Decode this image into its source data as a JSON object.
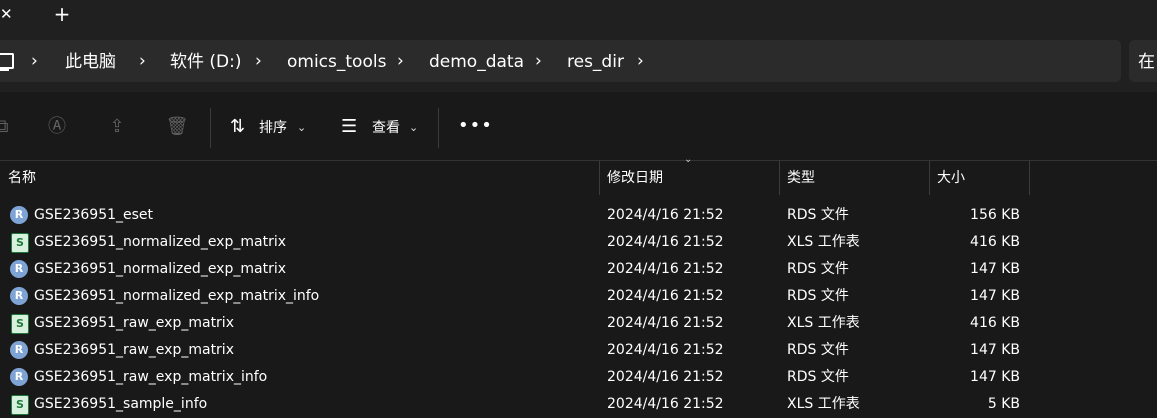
{
  "tab": {
    "close_icon": "close-icon",
    "new_tab_icon": "plus-icon"
  },
  "breadcrumb": {
    "items": [
      "此电脑",
      "软件 (D:)",
      "omics_tools",
      "demo_data",
      "res_dir"
    ],
    "search_prefix": "在"
  },
  "toolbar": {
    "sort_label": "排序",
    "view_label": "查看"
  },
  "columns": [
    "名称",
    "修改日期",
    "类型",
    "大小"
  ],
  "files": [
    {
      "name": "GSE236951_eset",
      "date": "2024/4/16 21:52",
      "type": "RDS 文件",
      "size": "156 KB",
      "icon": "R"
    },
    {
      "name": "GSE236951_normalized_exp_matrix",
      "date": "2024/4/16 21:52",
      "type": "XLS 工作表",
      "size": "416 KB",
      "icon": "S"
    },
    {
      "name": "GSE236951_normalized_exp_matrix",
      "date": "2024/4/16 21:52",
      "type": "RDS 文件",
      "size": "147 KB",
      "icon": "R"
    },
    {
      "name": "GSE236951_normalized_exp_matrix_info",
      "date": "2024/4/16 21:52",
      "type": "RDS 文件",
      "size": "147 KB",
      "icon": "R"
    },
    {
      "name": "GSE236951_raw_exp_matrix",
      "date": "2024/4/16 21:52",
      "type": "XLS 工作表",
      "size": "416 KB",
      "icon": "S"
    },
    {
      "name": "GSE236951_raw_exp_matrix",
      "date": "2024/4/16 21:52",
      "type": "RDS 文件",
      "size": "147 KB",
      "icon": "R"
    },
    {
      "name": "GSE236951_raw_exp_matrix_info",
      "date": "2024/4/16 21:52",
      "type": "RDS 文件",
      "size": "147 KB",
      "icon": "R"
    },
    {
      "name": "GSE236951_sample_info",
      "date": "2024/4/16 21:52",
      "type": "XLS 工作表",
      "size": "5 KB",
      "icon": "S"
    }
  ]
}
